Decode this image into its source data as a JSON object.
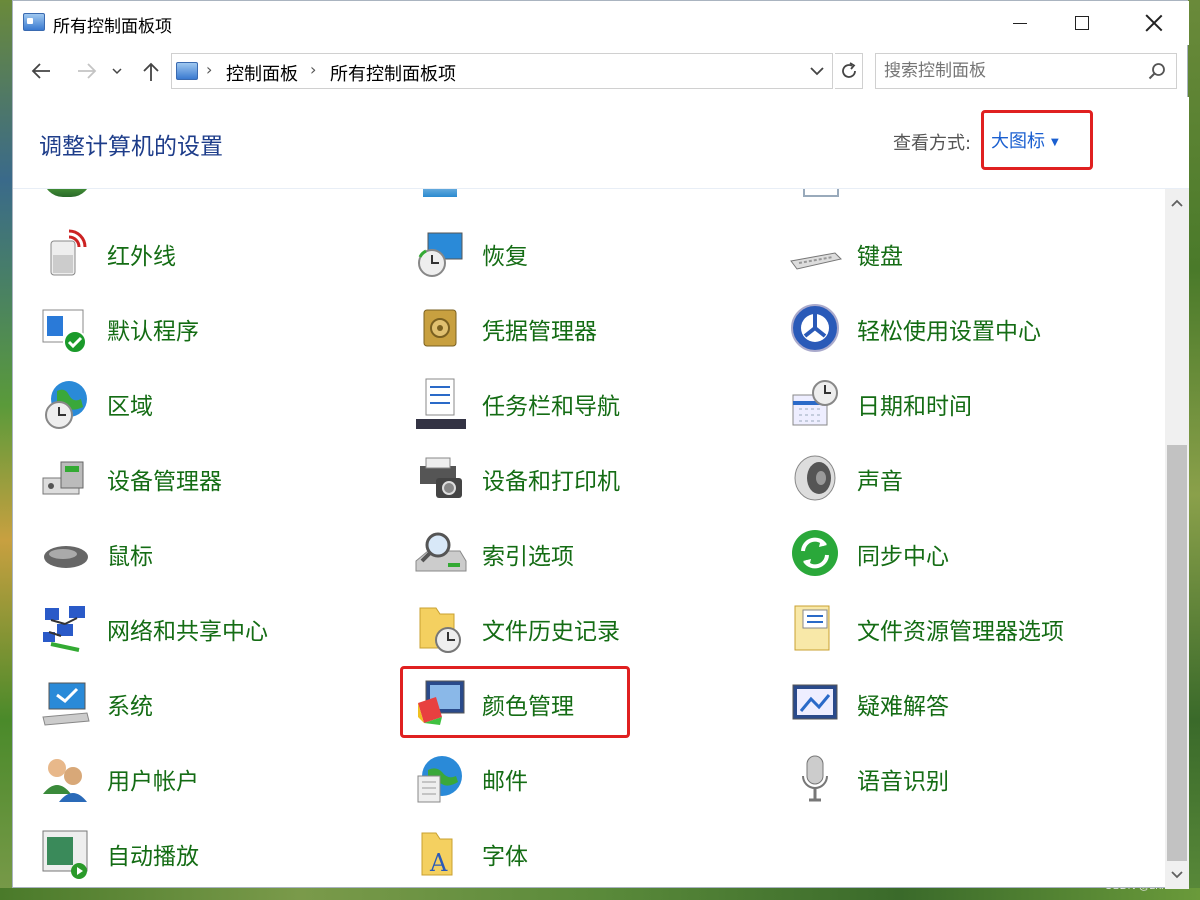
{
  "window": {
    "title": "所有控制面板项"
  },
  "nav": {
    "breadcrumb": [
      "控制面板",
      "所有控制面板项"
    ],
    "search_placeholder": "搜索控制面板"
  },
  "header": {
    "title": "调整计算机的设置",
    "view_label": "查看方式:",
    "view_value": "大图标"
  },
  "items": [
    {
      "label": "红外线",
      "icon": "infrared-icon"
    },
    {
      "label": "恢复",
      "icon": "recovery-icon"
    },
    {
      "label": "键盘",
      "icon": "keyboard-icon"
    },
    {
      "label": "默认程序",
      "icon": "default-programs-icon"
    },
    {
      "label": "凭据管理器",
      "icon": "credential-manager-icon"
    },
    {
      "label": "轻松使用设置中心",
      "icon": "ease-of-access-icon"
    },
    {
      "label": "区域",
      "icon": "region-icon"
    },
    {
      "label": "任务栏和导航",
      "icon": "taskbar-icon"
    },
    {
      "label": "日期和时间",
      "icon": "date-time-icon"
    },
    {
      "label": "设备管理器",
      "icon": "device-manager-icon"
    },
    {
      "label": "设备和打印机",
      "icon": "devices-printers-icon"
    },
    {
      "label": "声音",
      "icon": "sound-icon"
    },
    {
      "label": "鼠标",
      "icon": "mouse-icon"
    },
    {
      "label": "索引选项",
      "icon": "indexing-options-icon"
    },
    {
      "label": "同步中心",
      "icon": "sync-center-icon"
    },
    {
      "label": "网络和共享中心",
      "icon": "network-sharing-icon"
    },
    {
      "label": "文件历史记录",
      "icon": "file-history-icon"
    },
    {
      "label": "文件资源管理器选项",
      "icon": "file-explorer-options-icon"
    },
    {
      "label": "系统",
      "icon": "system-icon"
    },
    {
      "label": "颜色管理",
      "icon": "color-management-icon"
    },
    {
      "label": "疑难解答",
      "icon": "troubleshooting-icon"
    },
    {
      "label": "用户帐户",
      "icon": "user-accounts-icon"
    },
    {
      "label": "邮件",
      "icon": "mail-icon"
    },
    {
      "label": "语音识别",
      "icon": "speech-recognition-icon"
    },
    {
      "label": "自动播放",
      "icon": "autoplay-icon"
    },
    {
      "label": "字体",
      "icon": "fonts-icon"
    }
  ],
  "watermark": "CSDN @zhxczh",
  "colors": {
    "item_text": "#146c14",
    "title_text": "#1e3d8a",
    "link": "#1a5fd0",
    "highlight": "#e02020"
  }
}
